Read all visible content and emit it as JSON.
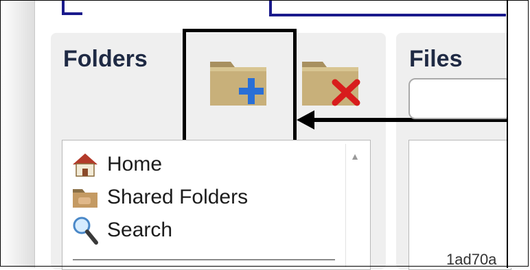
{
  "folders_panel": {
    "title": "Folders",
    "tree": [
      {
        "label": "Home",
        "icon": "home-icon"
      },
      {
        "label": "Shared Folders",
        "icon": "shared-folder-icon"
      },
      {
        "label": "Search",
        "icon": "search-icon"
      }
    ],
    "toolbar": {
      "new_folder_icon": "folder-add-icon",
      "delete_folder_icon": "folder-delete-icon"
    }
  },
  "files_panel": {
    "title": "Files",
    "search_value": "",
    "file_name": "1ad70a"
  },
  "annotation": {
    "highlight_target": "new-folder-button",
    "arrow_direction": "left"
  },
  "colors": {
    "title": "#1f2a44",
    "panel_bg": "#efefef",
    "folder_tan": "#c8b07a",
    "plus_blue": "#2a6fd6",
    "delete_red": "#d81c1c",
    "accent_navy": "#1a1a8c"
  }
}
